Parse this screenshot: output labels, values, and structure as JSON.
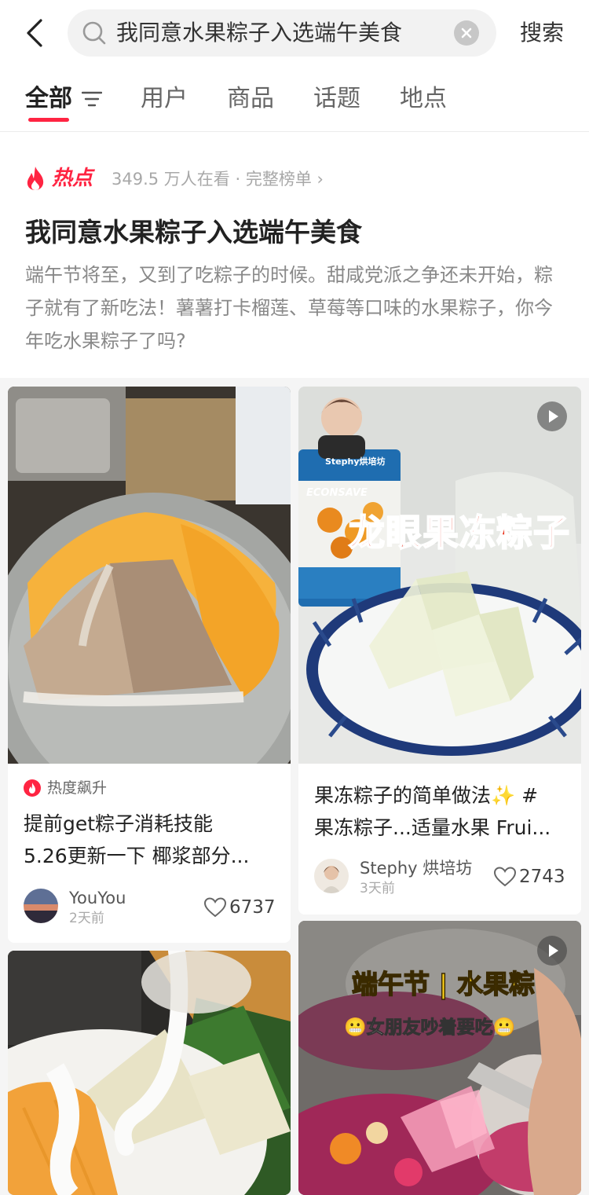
{
  "search": {
    "query": "我同意水果粽子入选端午美食",
    "submit_label": "搜索"
  },
  "tabs": [
    {
      "label": "全部",
      "active": true
    },
    {
      "label": "用户",
      "active": false
    },
    {
      "label": "商品",
      "active": false
    },
    {
      "label": "话题",
      "active": false
    },
    {
      "label": "地点",
      "active": false
    }
  ],
  "hot_topic": {
    "label": "热点",
    "meta": "349.5 万人在看 · 完整榜单 ›",
    "title": "我同意水果粽子入选端午美食",
    "description": "端午节将至，又到了吃粽子的时候。甜咸党派之争还未开始，粽子就有了新吃法！薯薯打卡榴莲、草莓等口味的水果粽子，你今年吃水果粽子了吗?"
  },
  "cards": [
    {
      "badge": "热度飙升",
      "title": "提前get粽子消耗技能\n5.26更新一下 椰浆部分...",
      "author": "YouYou",
      "posted": "2天前",
      "likes": "6737"
    },
    {
      "overlay_text": "龙眼果冻粽子",
      "watermark": "Stephy烘培坊",
      "can_label": "ECONSAVE",
      "title": "果冻粽子的简单做法✨ #\n果冻粽子...适量水果 Frui...",
      "author": "Stephy 烘培坊",
      "posted": "3天前",
      "likes": "2743"
    },
    {
      "overlay_title": "端午节 | 水果粽",
      "overlay_subtitle": "😬女朋友吵着要吃😬"
    },
    {}
  ],
  "colors": {
    "accent": "#ff2442",
    "feed_bg": "#f5f5f5"
  }
}
